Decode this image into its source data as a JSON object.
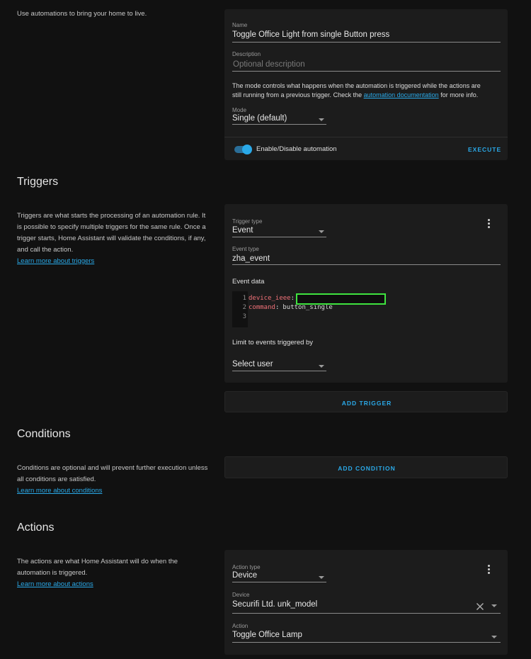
{
  "intro": {
    "text": "Use automations to bring your home to live."
  },
  "automation": {
    "name_label": "Name",
    "name_value": "Toggle Office Light from single Button press",
    "description_label": "Description",
    "description_placeholder": "Optional description",
    "mode_info_1": "The mode controls what happens when the automation is triggered while the actions are",
    "mode_info_2a": "still running from a previous trigger. Check the",
    "mode_info_link": "automation documentation",
    "mode_info_2b": "for more info.",
    "mode_label": "Mode",
    "mode_value": "Single (default)",
    "toggle_label": "Enable/Disable automation",
    "toggle_state": "on",
    "execute_label": "EXECUTE"
  },
  "triggers": {
    "title": "Triggers",
    "description_1": "Triggers are what starts the processing of an automation rule. It",
    "description_2": "is possible to specify multiple triggers for the same rule. Once a",
    "description_3": "trigger starts, Home Assistant will validate the conditions, if any,",
    "description_4": "and call the action.",
    "learn_more": "Learn more about triggers",
    "trigger_type_label": "Trigger type",
    "trigger_type_value": "Event",
    "event_type_label": "Event type",
    "event_type_value": "zha_event",
    "event_data_label": "Event data",
    "code": {
      "line_numbers": [
        "1",
        "2",
        "3"
      ],
      "key1": "device_ieee",
      "colon": ":",
      "key2": "command",
      "value2": "button_single"
    },
    "limit_label": "Limit to events triggered by",
    "select_user": "Select user",
    "add_trigger": "ADD TRIGGER"
  },
  "conditions": {
    "title": "Conditions",
    "description_1": "Conditions are optional and will prevent further execution unless",
    "description_2": "all conditions are satisfied.",
    "learn_more": "Learn more about conditions",
    "add_condition": "ADD CONDITION"
  },
  "actions": {
    "title": "Actions",
    "description_1": "The actions are what Home Assistant will do when the",
    "description_2": "automation is triggered.",
    "learn_more": "Learn more about actions",
    "action_type_label": "Action type",
    "action_type_value": "Device",
    "device_label": "Device",
    "device_value": "Securifi Ltd. unk_model",
    "action_label": "Action",
    "action_value": "Toggle Office Lamp"
  },
  "colors": {
    "accent": "#2aa9e8",
    "background": "#111111",
    "card": "#1c1c1c",
    "yaml_key": "#f07178",
    "highlight_box": "#3fe33f"
  }
}
